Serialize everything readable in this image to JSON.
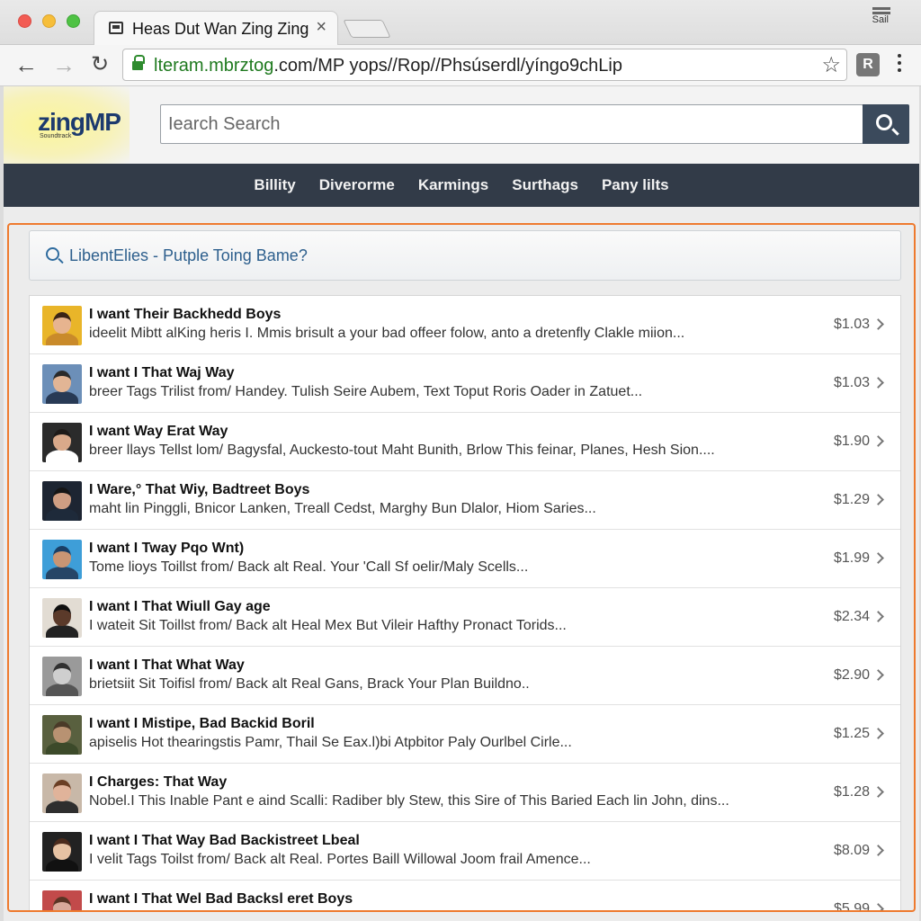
{
  "browser": {
    "tab_title": "Heas Dut Wan Zing Zing",
    "tab_close": "×",
    "profile_label": "Sail",
    "win_close": "✕",
    "url_host": "lteram.mbrztog",
    "url_rest": ".com/MP yops//Rop//Phsúserdl/yíngo9chLip",
    "nav_back": "←",
    "nav_forward": "→",
    "nav_reload": "↻",
    "star": "☆",
    "ext": "R"
  },
  "site": {
    "logo": "zingMP",
    "logo_tagline": "Soundtrack",
    "search_placeholder": "Search",
    "search_value": "Iearch Search"
  },
  "nav": {
    "items": [
      "Billity",
      "Diverorme",
      "Karmings",
      "Surthags",
      "Pany lilts"
    ]
  },
  "query": {
    "text": "LibentElies  -  Putple Toing Bame?"
  },
  "results": [
    {
      "title": "I want Their Backhedd Boys",
      "desc": "ideelit Mibtt alKing heris I. Mmis brisult a your bad offeer folow, anto a dretenfly Clakle miion...",
      "price": "$1.03",
      "skin": "#e7b48f",
      "hair": "#3a2416",
      "shirt": "#c98a2a",
      "bg": "#e9b529"
    },
    {
      "title": "I want I That Waj Way",
      "desc": "breer Tags Trilist  from/ Handey. Tulish Seire Aubem, Text Toput Roris Oader in Zatuet...",
      "price": "$1.03",
      "skin": "#e2b595",
      "hair": "#2a2a2a",
      "shirt": "#283a55",
      "bg": "#6c8fb8"
    },
    {
      "title": "I want Way Erat Way",
      "desc": "breer llays Tellst  lom/ Bagysfal, Auckesto-tout Maht Bunith, Brlow This feinar, Planes, Hesh Sion....",
      "price": "$1.90",
      "skin": "#d9a98a",
      "hair": "#1e1a18",
      "shirt": "#ffffff",
      "bg": "#2b2b2b"
    },
    {
      "title": "I Ware,° That Wiy, Badtreet Boys",
      "desc": "maht lin Pinggli, Bnicor Lanken, Treall Cedst, Marghy Bun Dlalor, Hiom Saries...",
      "price": "$1.29",
      "skin": "#cf9e83",
      "hair": "#161616",
      "shirt": "#1e2a3a",
      "bg": "#1d2532"
    },
    {
      "title": "I want I Tway Pqo Wnt)",
      "desc": "Tome lioys Toillst  from/ Back alt Real. Your 'Call  Sf oelir/Maly Scells...",
      "price": "$1.99",
      "skin": "#c99574",
      "hair": "#1a3f66",
      "shirt": "#264566",
      "bg": "#3e9ed8"
    },
    {
      "title": "I want I That Wiull Gay age",
      "desc": "I wateit Sit Toillst  from/ Back alt Heal Mex But Vileir Hafthy Pronact Torids...",
      "price": "$2.34",
      "skin": "#5b3a2a",
      "hair": "#0f0f0f",
      "shirt": "#222222",
      "bg": "#e2dcd3"
    },
    {
      "title": "I want I That What Way",
      "desc": "brietsiit Sit Toifisl  from/ Back alt Real Gans, Brack Your Plan Buildno..",
      "price": "$2.90",
      "skin": "#cfcfcf",
      "hair": "#303030",
      "shirt": "#555555",
      "bg": "#9a9a9a"
    },
    {
      "title": "I want I Mistipe, Bad Backid Boril",
      "desc": "apiselis Hot thearingstis Pamr, Thail Se Eax.l)bi Atpbitor Paly Ourlbel Cirle...",
      "price": "$1.25",
      "skin": "#b89272",
      "hair": "#4a3a28",
      "shirt": "#3c4a2a",
      "bg": "#59603f"
    },
    {
      "title": "I Charges: That Way",
      "desc": "Nobel.I This Inable Pant e aind Scalli: Radiber bly Stew, this Sire of This Baried Each lin John, dins...",
      "price": "$1.28",
      "skin": "#e0b39a",
      "hair": "#6b3f25",
      "shirt": "#2e2e2e",
      "bg": "#c8b8a8"
    },
    {
      "title": "I want I That Way Bad Backistreet Lbeal",
      "desc": "I velit Tags Toilst  from/ Back alt Real. Portes Baill Willowal Joom frail Amence...",
      "price": "$8.09",
      "skin": "#e6c2a3",
      "hair": "#4a2b1c",
      "shirt": "#111111",
      "bg": "#222222"
    },
    {
      "title": "I want I That Wel Bad Backsl eret Boys",
      "desc": "",
      "price": "$5.99",
      "skin": "#d8a99a",
      "hair": "#5a3424",
      "shirt": "#a43030",
      "bg": "#c24a4a"
    }
  ]
}
